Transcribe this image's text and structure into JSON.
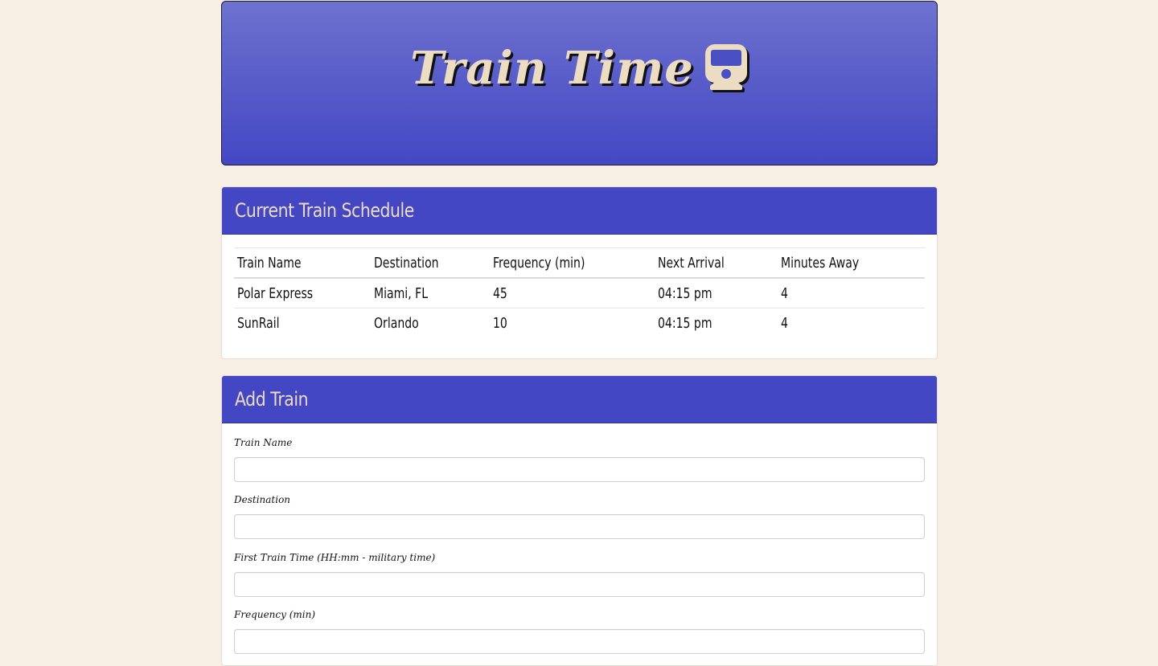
{
  "header": {
    "title": "Train Time",
    "icon": "train-icon"
  },
  "schedule": {
    "heading": "Current Train Schedule",
    "columns": [
      "Train Name",
      "Destination",
      "Frequency (min)",
      "Next Arrival",
      "Minutes Away"
    ],
    "rows": [
      [
        "Polar Express",
        "Miami, FL",
        "45",
        "04:15 pm",
        "4"
      ],
      [
        "SunRail",
        "Orlando",
        "10",
        "04:15 pm",
        "4"
      ]
    ]
  },
  "add_train": {
    "heading": "Add Train",
    "fields": [
      {
        "label": "Train Name",
        "value": ""
      },
      {
        "label": "Destination",
        "value": ""
      },
      {
        "label": "First Train Time (HH:mm - military time)",
        "value": ""
      },
      {
        "label": "Frequency (min)",
        "value": ""
      }
    ]
  },
  "colors": {
    "background": "#f8efe4",
    "accent": "#4347c4",
    "title_text": "#ecdcc2"
  }
}
